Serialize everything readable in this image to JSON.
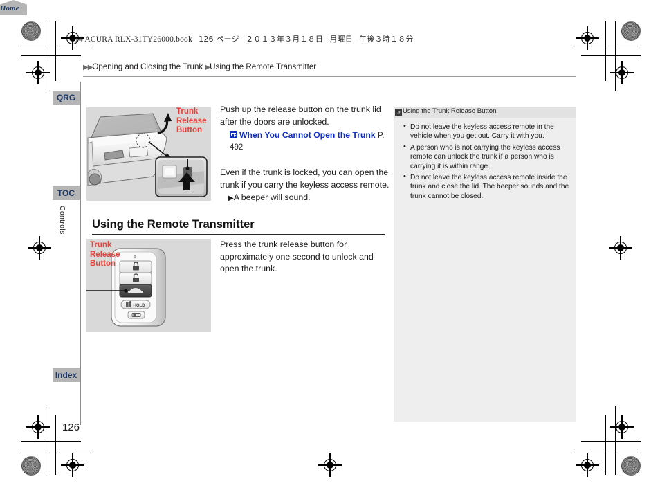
{
  "print_header": {
    "text": "14 ACURA RLX-31TY26000.book",
    "page_label": "126 ページ",
    "date": "２０１３年３月１８日",
    "weekday": "月曜日",
    "time": "午後３時１８分"
  },
  "breadcrumb": {
    "marker": "▶▶",
    "level1": "Opening and Closing the Trunk",
    "separator": "▶",
    "level2": "Using the Remote Transmitter"
  },
  "sidebar": {
    "qrg_label": "QRG",
    "toc_label": "TOC",
    "index_label": "Index",
    "home_label": "Home",
    "chapter_label": "Controls"
  },
  "page_number": "126",
  "figures": {
    "car": {
      "callout": "Trunk\nRelease\nButton",
      "callout_lines": [
        "Trunk",
        "Release",
        "Button"
      ],
      "alt": "Rear view of sedan trunk with release button detail inset"
    },
    "fob": {
      "callout_lines": [
        "Trunk",
        "Release",
        "Button"
      ],
      "alt": "Keyless access remote transmitter with trunk release button highlighted",
      "buttons": [
        "lock-icon",
        "unlock-icon",
        "trunk-icon",
        "panic-hold-icon",
        "remote-start-icon"
      ],
      "hold_label": "HOLD"
    }
  },
  "main": {
    "para1": "Push up the release button on the trunk lid after the doors are unlocked.",
    "xref": {
      "icon": "jump-arrow-icon",
      "label": "When You Cannot Open the Trunk",
      "page": "P. 492"
    },
    "para2": "Even if the trunk is locked, you can open the trunk if you carry the keyless access remote.",
    "bullet1_marker": "▶",
    "bullet1": "A beeper will sound.",
    "section_heading": "Using the Remote Transmitter",
    "para3": "Press the trunk release button for approximately one second to unlock and open the trunk."
  },
  "note": {
    "icon": "note-marker-icon",
    "title": "Using the Trunk Release Button",
    "items": [
      "Do not leave the keyless access remote in the vehicle when you get out. Carry it with you.",
      "A person who is not carrying the keyless access remote can unlock the trunk if a person who is carrying it is within range.",
      "Do not leave the keyless access remote inside the trunk and close the lid. The beeper sounds and the trunk cannot be closed."
    ]
  },
  "colors": {
    "callout_red": "#e8413c",
    "xref_blue": "#0f2ec4",
    "tab_gray": "#b5b5b5",
    "tab_text": "#1f3864",
    "note_bg": "#eeeeee",
    "figure_bg": "#d9d9d9"
  }
}
